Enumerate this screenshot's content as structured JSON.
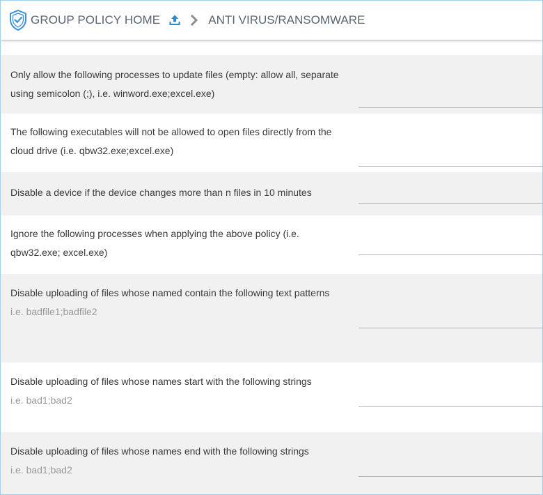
{
  "header": {
    "home_label": "GROUP POLICY HOME",
    "current_label": "ANTI VIRUS/RANSOMWARE",
    "icons": {
      "logo": "shield-check-icon",
      "upload": "upload-icon",
      "separator": "chevron-right-icon"
    },
    "accent_color": "#3a8fd6"
  },
  "settings": [
    {
      "label": "Only allow the following processes to update files (empty: allow all, separate using semicolon (;), i.e. winword.exe;excel.exe)",
      "hint": "",
      "value": ""
    },
    {
      "label": "The following executables will not be allowed to open files directly from the cloud drive (i.e. qbw32.exe;excel.exe)",
      "hint": "",
      "value": ""
    },
    {
      "label": "Disable a device if the device changes more than n files in 10 minutes",
      "hint": "",
      "value": ""
    },
    {
      "label": "Ignore the following processes when applying the above policy (i.e. qbw32.exe; excel.exe)",
      "hint": "",
      "value": ""
    },
    {
      "label": "Disable uploading of files whose named contain the following text patterns",
      "hint": "i.e. badfile1;badfile2",
      "value": ""
    },
    {
      "label": "Disable uploading of files whose names start with the following strings",
      "hint": "i.e. bad1;bad2",
      "value": ""
    },
    {
      "label": "Disable uploading of files whose names end with the following strings",
      "hint": "i.e. bad1;bad2",
      "value": ""
    }
  ]
}
